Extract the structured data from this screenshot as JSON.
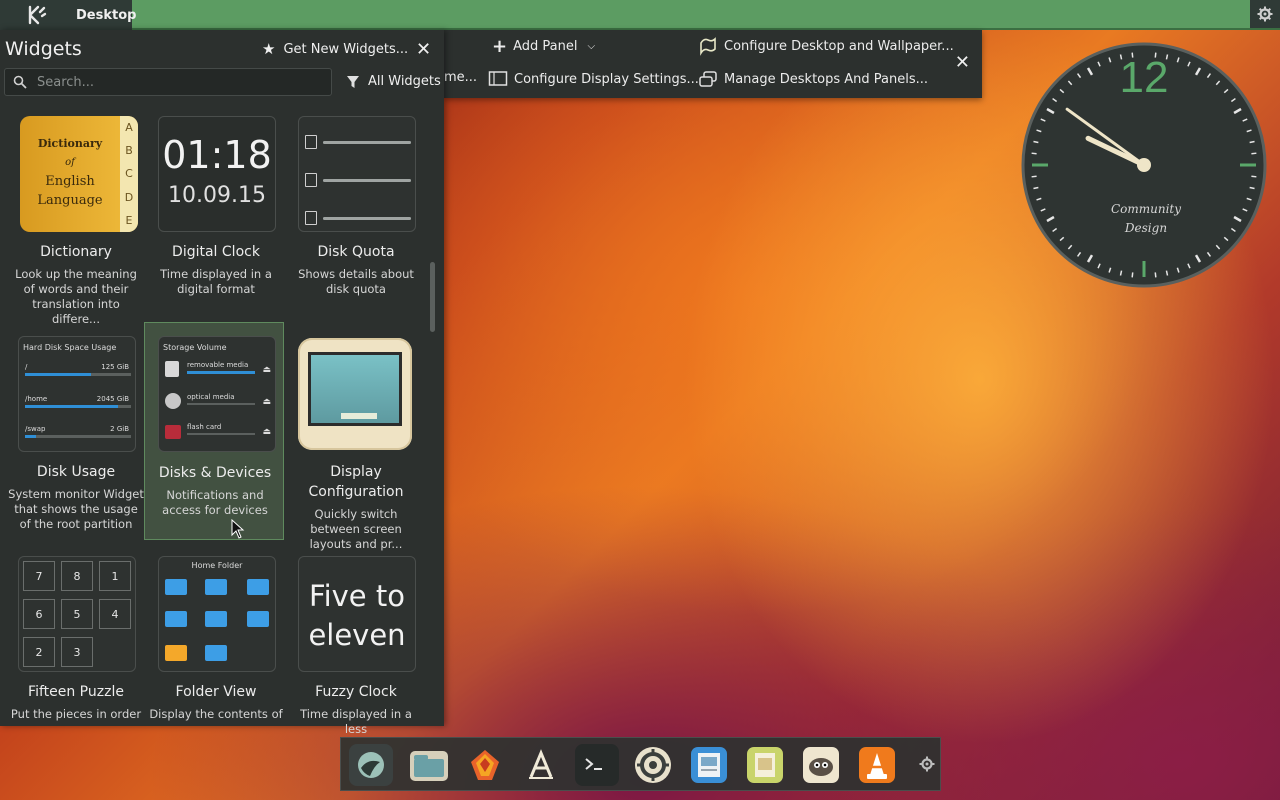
{
  "topbar": {
    "title": "Desktop"
  },
  "widgets_panel": {
    "title": "Widgets",
    "get_new_label": "Get New Widgets...",
    "search_placeholder": "Search...",
    "filter_label": "All Widgets",
    "items": [
      {
        "name": "Dictionary",
        "desc": "Look up the meaning of words and their translation into differe..."
      },
      {
        "name": "Digital Clock",
        "desc": "Time displayed in a digital format"
      },
      {
        "name": "Disk Quota",
        "desc": "Shows details about disk quota"
      },
      {
        "name": "Disk Usage",
        "desc": "System monitor Widget that shows the usage of the root partition"
      },
      {
        "name": "Disks & Devices",
        "desc": "Notifications and access for devices"
      },
      {
        "name": "Display Configuration",
        "desc": "Quickly switch between screen layouts and pr..."
      },
      {
        "name": "Fifteen Puzzle",
        "desc": "Put the pieces in order"
      },
      {
        "name": "Folder View",
        "desc": "Display the contents of"
      },
      {
        "name": "Fuzzy Clock",
        "desc": "Time displayed in a less"
      }
    ],
    "thumbs": {
      "dictionary": {
        "line1": "Dictionary",
        "line2": "of",
        "line3": "English",
        "line4": "Language",
        "letters": [
          "A",
          "B",
          "C",
          "D",
          "E"
        ]
      },
      "digital_clock": {
        "time": "01:18",
        "date": "10.09.15"
      },
      "disk_usage": {
        "title": "Hard Disk Space Usage",
        "rows": [
          {
            "mount": "/",
            "size": "125 GiB",
            "fraction": 0.62
          },
          {
            "mount": "/home",
            "size": "2045 GiB",
            "fraction": 0.88
          },
          {
            "mount": "/swap",
            "size": "2 GiB",
            "fraction": 0.1
          }
        ]
      },
      "disks_devices": {
        "title": "Storage Volume",
        "rows": [
          "removable media",
          "optical media",
          "flash card"
        ]
      },
      "puzzle": [
        "7",
        "8",
        "1",
        "6",
        "5",
        "4",
        "2",
        "3"
      ],
      "folder_view": {
        "title": "Home Folder"
      },
      "fuzzy_clock": {
        "line1": "Five to",
        "line2": "eleven"
      }
    }
  },
  "desktop_toolbar": {
    "add_panel": "Add Panel",
    "configure_desktop": "Configure Desktop and Wallpaper...",
    "truncated_left": "me...",
    "configure_display": "Configure Display Settings...",
    "manage_desktops": "Manage Desktops And Panels..."
  },
  "analog_clock": {
    "numeral": "12",
    "label_line1": "Community",
    "label_line2": "Design",
    "hour": 9,
    "minute": 51
  },
  "dock": {
    "apps": [
      "app-launcher-icon",
      "files-icon",
      "firefox-icon",
      "text-editor-icon",
      "terminal-icon",
      "settings-icon",
      "image-viewer-icon",
      "document-icon",
      "gimp-icon",
      "vlc-icon"
    ]
  },
  "colors": {
    "accent_green": "#5c9c62",
    "panel_bg": "#2c302e",
    "clock_accent": "#5aa86a"
  }
}
